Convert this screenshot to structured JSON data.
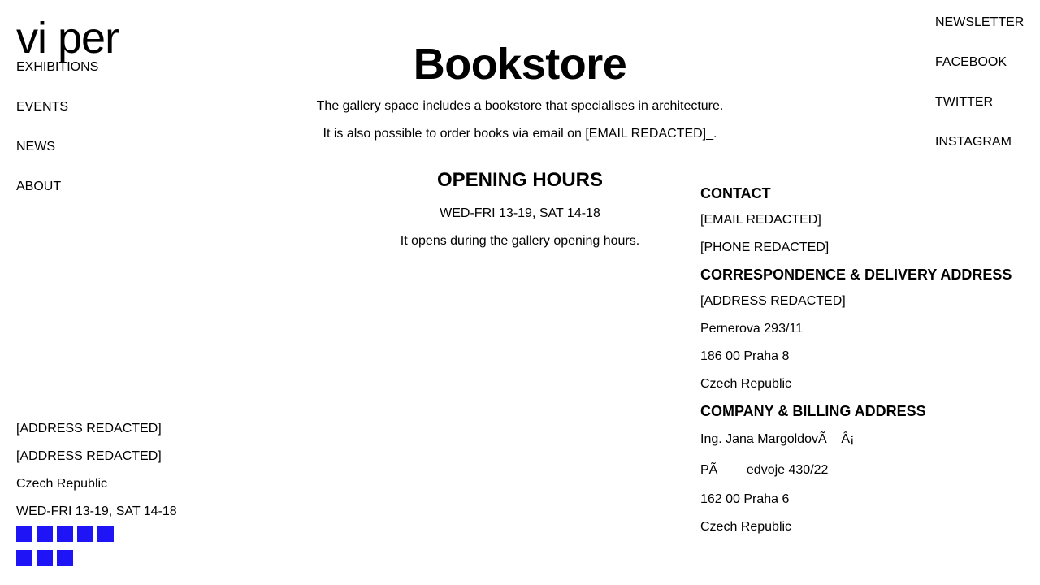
{
  "logo": "vi per",
  "nav_left": [
    {
      "label": "EXHIBITIONS"
    },
    {
      "label": "EVENTS"
    },
    {
      "label": "NEWS"
    },
    {
      "label": "ABOUT"
    }
  ],
  "nav_right": [
    {
      "label": "NEWSLETTER"
    },
    {
      "label": "FACEBOOK"
    },
    {
      "label": "TWITTER"
    },
    {
      "label": "INSTAGRAM"
    }
  ],
  "main": {
    "title": "Bookstore",
    "intro_1": "The gallery space includes a bookstore that specialises in architecture.",
    "intro_2": "It is also possible to order books via email on [EMAIL REDACTED]_.",
    "hours_heading": "OPENING HOURS",
    "hours_text": "WED-FRI 13-19, SAT 14-18",
    "hours_note": "It opens during the gallery opening hours."
  },
  "contact": {
    "heading": "CONTACT",
    "email": "[EMAIL REDACTED]",
    "phone": "[PHONE REDACTED]",
    "correspondence_heading": "CORRESPONDENCE & DELIVERY ADDRESS",
    "correspondence_lines": [
      "[ADDRESS REDACTED]",
      "Pernerova 293/11",
      "186 00 Praha 8",
      "Czech Republic"
    ],
    "billing_heading": "COMPANY & BILLING ADDRESS",
    "billing_lines": [
      "Ing. Jana MargoldovÃ    Â¡",
      "PÃ        edvoje 430/22",
      "162 00 Praha 6",
      "Czech Republic"
    ]
  },
  "footer": {
    "address_1": "[ADDRESS REDACTED]",
    "address_2": "[ADDRESS REDACTED]",
    "country": "Czech Republic",
    "hours": "WED-FRI 13-19, SAT 14-18",
    "square_color": "#1f14f5",
    "square_row_1_count": 5,
    "square_row_2_count": 3
  }
}
